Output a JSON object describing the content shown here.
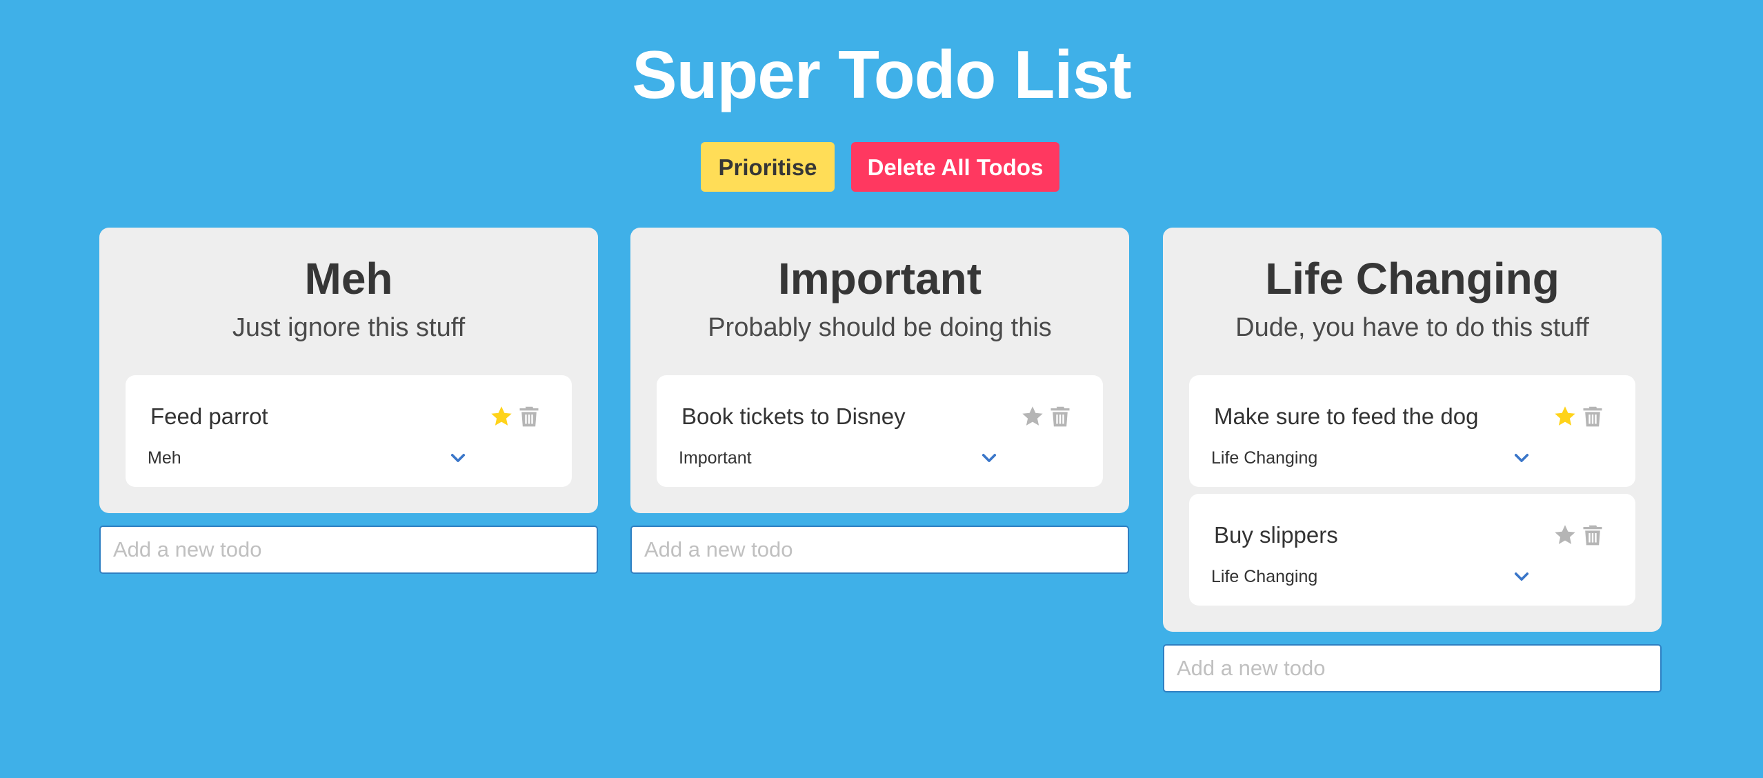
{
  "header": {
    "title": "Super Todo List"
  },
  "toolbar": {
    "prioritise_label": "Prioritise",
    "delete_all_label": "Delete All Todos"
  },
  "colors": {
    "background": "#3fb0e8",
    "prioritise": "#ffdd57",
    "delete": "#ff3860",
    "star_active": "#ffd31a",
    "star_inactive": "#b5b5b5",
    "chevron": "#3a76c9"
  },
  "columns": [
    {
      "title": "Meh",
      "subtitle": "Just ignore this stuff",
      "new_todo_placeholder": "Add a new todo",
      "todos": [
        {
          "text": "Feed parrot",
          "priority": "Meh",
          "starred": true
        }
      ]
    },
    {
      "title": "Important",
      "subtitle": "Probably should be doing this",
      "new_todo_placeholder": "Add a new todo",
      "todos": [
        {
          "text": "Book tickets to Disney",
          "priority": "Important",
          "starred": false
        }
      ]
    },
    {
      "title": "Life Changing",
      "subtitle": "Dude, you have to do this stuff",
      "new_todo_placeholder": "Add a new todo",
      "todos": [
        {
          "text": "Make sure to feed the dog",
          "priority": "Life Changing",
          "starred": true
        },
        {
          "text": "Buy slippers",
          "priority": "Life Changing",
          "starred": false
        }
      ]
    }
  ],
  "icons": {
    "star": "star-icon",
    "trash": "trash-icon",
    "chevron": "chevron-down-icon"
  }
}
